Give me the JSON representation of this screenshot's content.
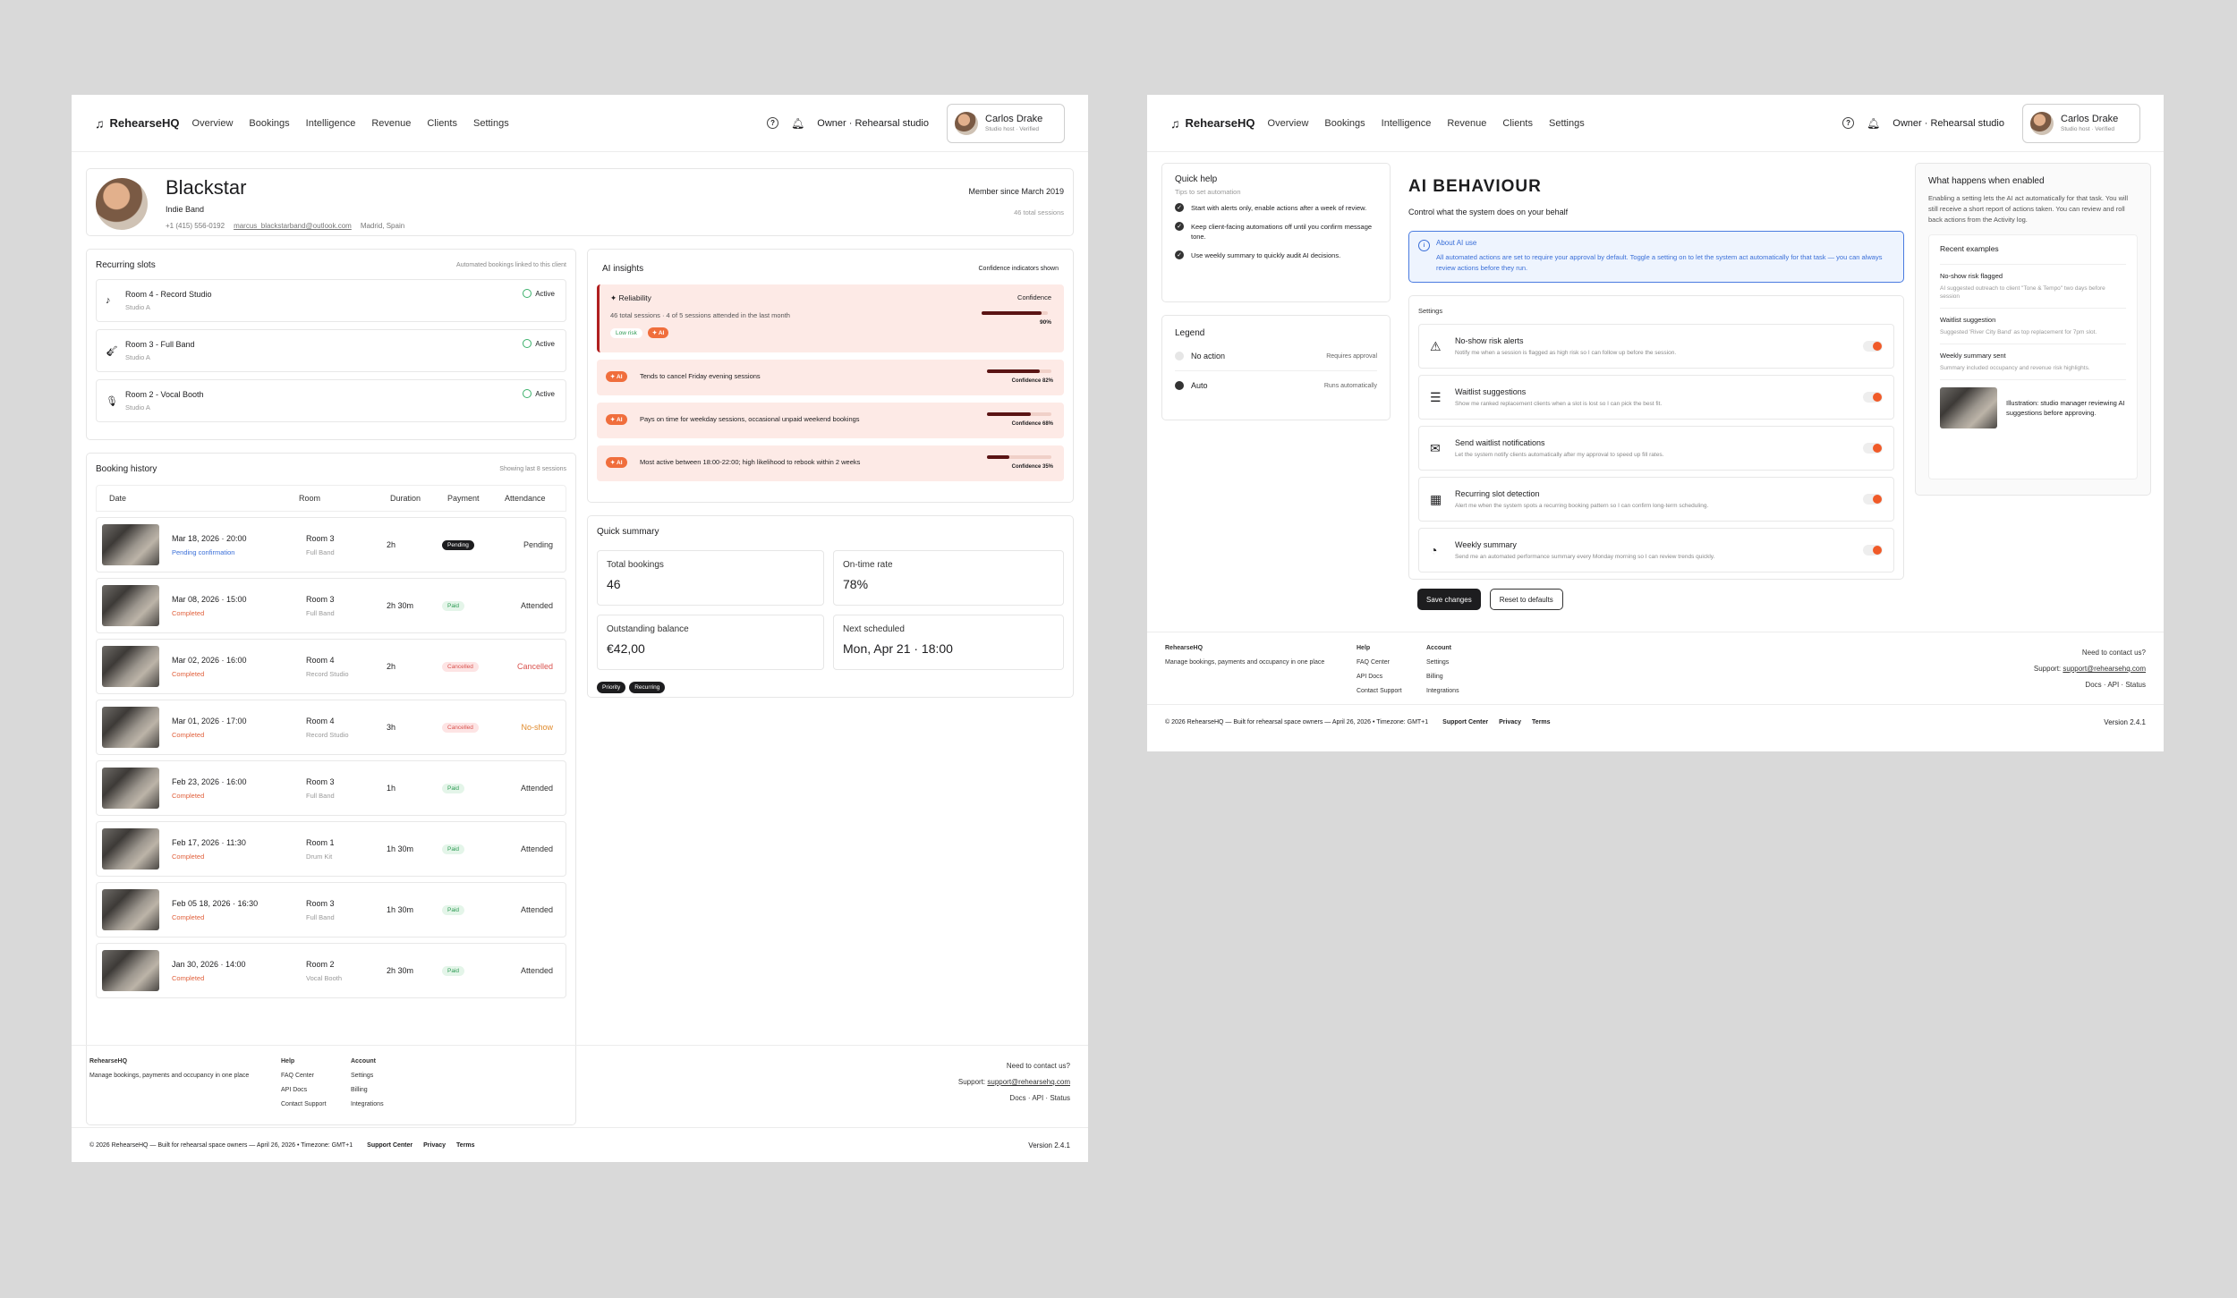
{
  "nav": {
    "brand": "RehearseHQ",
    "links": [
      "Overview",
      "Bookings",
      "Intelligence",
      "Revenue",
      "Clients",
      "Settings"
    ],
    "owner": "Owner · Rehearsal studio",
    "user_name": "Carlos Drake",
    "user_sub": "Studio host · Verified"
  },
  "profile": {
    "name": "Blackstar",
    "type": "Indie Band",
    "phone": "+1 (415) 556-0192",
    "email": "marcus_blackstarband@outlook.com",
    "location": "Madrid, Spain",
    "member_since": "Member since March 2019",
    "total_sessions": "46 total sessions"
  },
  "recurring": {
    "title": "Recurring slots",
    "note": "Automated bookings linked to this client",
    "items": [
      {
        "name": "Room 4 - Record Studio",
        "sub": "Studio A",
        "status": "Active",
        "icon": "note-icon"
      },
      {
        "name": "Room 3 - Full Band",
        "sub": "Studio A",
        "status": "Active",
        "icon": "guitar-icon"
      },
      {
        "name": "Room 2 - Vocal Booth",
        "sub": "Studio A",
        "status": "Active",
        "icon": "mic-icon"
      }
    ]
  },
  "history": {
    "title": "Booking history",
    "note": "Showing last 8 sessions",
    "cols": [
      "Date",
      "Room",
      "Duration",
      "Payment",
      "Attendance"
    ],
    "rows": [
      {
        "date": "Mar 18, 2026 · 20:00",
        "status": "Pending confirmation",
        "room": "Room 3",
        "sub": "Full Band",
        "dur": "2h",
        "pay": "Pending",
        "att": "Pending"
      },
      {
        "date": "Mar 08, 2026 · 15:00",
        "status": "Completed",
        "room": "Room 3",
        "sub": "Full Band",
        "dur": "2h 30m",
        "pay": "Paid",
        "att": "Attended"
      },
      {
        "date": "Mar 02, 2026 · 16:00",
        "status": "Completed",
        "room": "Room 4",
        "sub": "Record Studio",
        "dur": "2h",
        "pay": "Cancelled",
        "att": "Cancelled"
      },
      {
        "date": "Mar 01, 2026 · 17:00",
        "status": "Completed",
        "room": "Room 4",
        "sub": "Record Studio",
        "dur": "3h",
        "pay": "Cancelled",
        "att": "No-show"
      },
      {
        "date": "Feb 23, 2026 · 16:00",
        "status": "Completed",
        "room": "Room 3",
        "sub": "Full Band",
        "dur": "1h",
        "pay": "Paid",
        "att": "Attended"
      },
      {
        "date": "Feb 17, 2026 · 11:30",
        "status": "Completed",
        "room": "Room 1",
        "sub": "Drum Kit",
        "dur": "1h 30m",
        "pay": "Paid",
        "att": "Attended"
      },
      {
        "date": "Feb 05 18, 2026 · 16:30",
        "status": "Completed",
        "room": "Room 3",
        "sub": "Full Band",
        "dur": "1h 30m",
        "pay": "Paid",
        "att": "Attended"
      },
      {
        "date": "Jan 30, 2026 · 14:00",
        "status": "Completed",
        "room": "Room 2",
        "sub": "Vocal Booth",
        "dur": "2h 30m",
        "pay": "Paid",
        "att": "Attended"
      }
    ]
  },
  "insights": {
    "title": "AI insights",
    "note": "Confidence indicators shown",
    "main": {
      "title": "Reliability",
      "desc": "46 total sessions · 4 of 5 sessions attended in the last month",
      "risk": "Low risk",
      "ai": "AI",
      "conf_label": "Confidence",
      "conf": "90%",
      "level": 0.9
    },
    "items": [
      {
        "text": "Tends to cancel Friday evening sessions",
        "conf": "Confidence 82%",
        "level": 0.82
      },
      {
        "text": "Pays on time for weekday sessions, occasional unpaid weekend bookings",
        "conf": "Confidence 68%",
        "level": 0.68
      },
      {
        "text": "Most active between 18:00-22:00; high likelihood to rebook within 2 weeks",
        "conf": "Confidence 35%",
        "level": 0.35
      }
    ]
  },
  "summary": {
    "title": "Quick summary",
    "stats": [
      {
        "label": "Total bookings",
        "value": "46"
      },
      {
        "label": "On-time rate",
        "value": "78%"
      },
      {
        "label": "Outstanding balance",
        "value": "€42,00"
      },
      {
        "label": "Next scheduled",
        "value": "Mon, Apr 21 · 18:00"
      }
    ],
    "tags": [
      "Priority",
      "Recurring"
    ]
  },
  "footer": {
    "brand": "RehearseHQ",
    "tagline": "Manage bookings, payments and occupancy in one place",
    "help_title": "Help",
    "help": [
      "FAQ Center",
      "API Docs",
      "Contact Support"
    ],
    "account_title": "Account",
    "account": [
      "Settings",
      "Billing",
      "Integrations"
    ],
    "contact": "Need to contact us?",
    "support_label": "Support:",
    "support_email": "support@rehearsehq.com",
    "links": "Docs · API · Status",
    "copyright": "© 2026 RehearseHQ — Built for rehearsal space owners — April 26, 2026 • Timezone: GMT+1",
    "bottom_links": [
      "Support Center",
      "Privacy",
      "Terms"
    ],
    "version": "Version 2.4.1"
  },
  "quickhelp": {
    "title": "Quick help",
    "sub": "Tips to set automation",
    "tips": [
      "Start with alerts only, enable actions after a week of review.",
      "Keep client-facing automations off until you confirm message tone.",
      "Use weekly summary to quickly audit AI decisions."
    ]
  },
  "legend": {
    "title": "Legend",
    "items": [
      {
        "label": "No action",
        "desc": "Requires approval"
      },
      {
        "label": "Auto",
        "desc": "Runs automatically"
      }
    ]
  },
  "ai": {
    "title": "AI BEHAVIOUR",
    "sub": "Control what the system does on your behalf",
    "info_title": "About AI use",
    "info_text": "All automated actions are set to require your approval by default. Toggle a setting on to let the system act automatically for that task — you can always review actions before they run.",
    "settings_label": "Settings",
    "settings": [
      {
        "title": "No-show risk alerts",
        "desc": "Notify me when a session is flagged as high risk so I can follow up before the session.",
        "icon": "warning-icon"
      },
      {
        "title": "Waitlist suggestions",
        "desc": "Show me ranked replacement clients when a slot is lost so I can pick the best fit.",
        "icon": "list-icon"
      },
      {
        "title": "Send waitlist notifications",
        "desc": "Let the system notify clients automatically after my approval to speed up fill rates.",
        "icon": "mail-icon"
      },
      {
        "title": "Recurring slot detection",
        "desc": "Alert me when the system spots a recurring booking pattern so I can confirm long-term scheduling.",
        "icon": "calendar-icon"
      },
      {
        "title": "Weekly summary",
        "desc": "Send me an automated performance summary every Monday morning so I can review trends quickly.",
        "icon": "chart-icon"
      }
    ],
    "save": "Save changes",
    "reset": "Reset to defaults"
  },
  "enabled": {
    "title": "What happens when enabled",
    "desc": "Enabling a setting lets the AI act automatically for that task. You will still receive a short report of actions taken. You can review and roll back actions from the Activity log.",
    "recent": "Recent examples",
    "examples": [
      {
        "t": "No-show risk flagged",
        "d": "AI suggested outreach to client \"Tone & Tempo\" two days before session"
      },
      {
        "t": "Waitlist suggestion",
        "d": "Suggested 'River City Band' as top replacement for 7pm slot."
      },
      {
        "t": "Weekly summary sent",
        "d": "Summary included occupancy and revenue risk highlights."
      }
    ],
    "illustration": "Illustration: studio manager reviewing AI suggestions before approving."
  },
  "colors": {
    "accent": "#f05a28",
    "completed": "#e0603c",
    "pending_link": "#3a6fd8",
    "info_bg": "#eef4fe"
  }
}
